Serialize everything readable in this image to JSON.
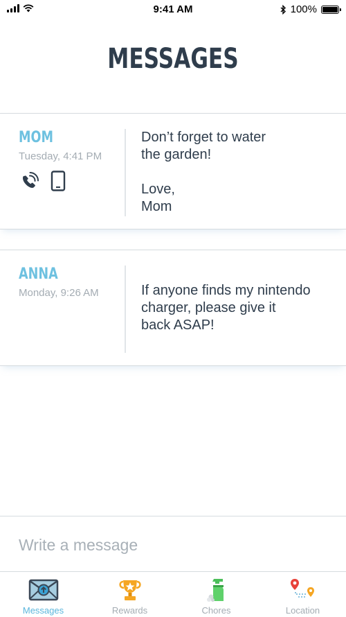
{
  "status_bar": {
    "time": "9:41 AM",
    "battery": "100%",
    "battery_level": 1.0
  },
  "header": {
    "title": "MESSAGES"
  },
  "messages": [
    {
      "sender": "MOM",
      "time": "Tuesday, 4:41 PM",
      "text": "Don’t forget to water\nthe garden!\n\nLove,\nMom",
      "icons": [
        "phone-wave-icon",
        "smartphone-icon"
      ]
    },
    {
      "sender": "ANNA",
      "time": "Monday, 9:26 AM",
      "text": "If anyone finds my nintendo\ncharger, please give it\nback ASAP!",
      "icons": []
    }
  ],
  "compose": {
    "placeholder": "Write a message"
  },
  "tabs": [
    {
      "label": "Messages",
      "icon": "envelope-icon",
      "active": true
    },
    {
      "label": "Rewards",
      "icon": "trophy-icon",
      "active": false
    },
    {
      "label": "Chores",
      "icon": "spray-bottle-icon",
      "active": false
    },
    {
      "label": "Location",
      "icon": "map-pins-icon",
      "active": false
    }
  ],
  "colors": {
    "accent": "#5bb6dc",
    "sender_name": "#6ec1e0",
    "title": "#2f3d4c",
    "muted": "#a4acb3"
  }
}
